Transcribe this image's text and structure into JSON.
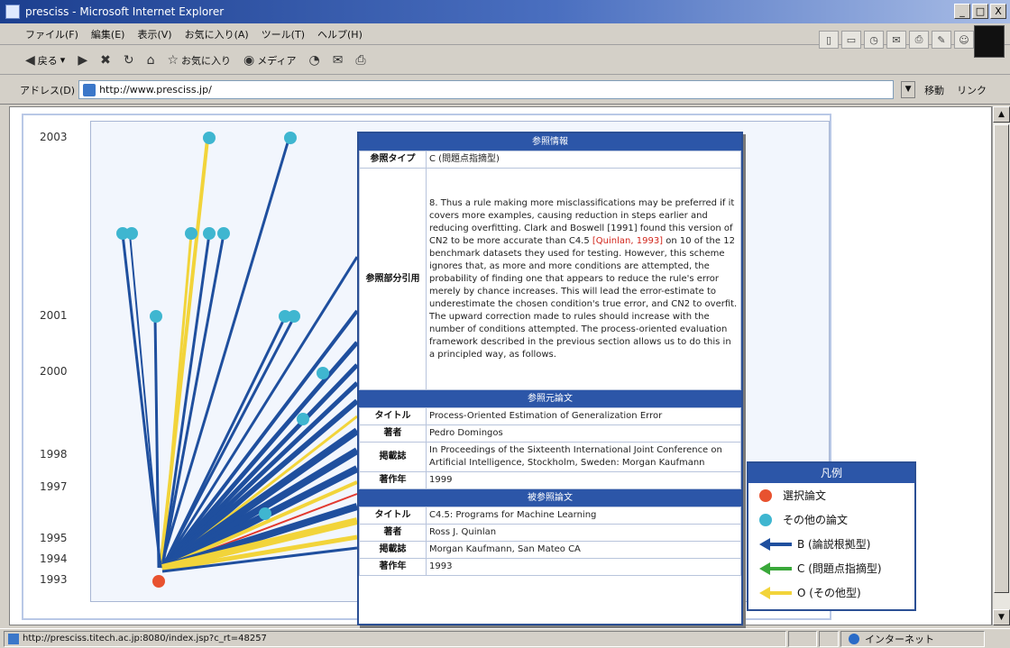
{
  "window": {
    "title": "presciss - Microsoft Internet Explorer",
    "minimize": "_",
    "maximize": "□",
    "close": "X"
  },
  "menu": [
    "ファイル(F)",
    "編集(E)",
    "表示(V)",
    "お気に入り(A)",
    "ツール(T)",
    "ヘルプ(H)"
  ],
  "toolbar": {
    "back": "戻る",
    "favorites": "お気に入り",
    "media": "メディア"
  },
  "address": {
    "label": "アドレス(D)",
    "url": "http://www.presciss.jp/",
    "go": "移動",
    "links": "リンク"
  },
  "years": [
    "2003",
    "2001",
    "2000",
    "1998",
    "1997",
    "1995",
    "1994",
    "1993"
  ],
  "popup": {
    "ref_section": "参照情報",
    "ref_type_label": "参照タイプ",
    "ref_type_value": "C (問題点指摘型)",
    "quote_label": "参照部分引用",
    "quote_pre": "8. Thus a rule making more misclassifications may be preferred if it covers more examples, causing reduction in steps earlier and reducing overfitting. Clark and Boswell [1991] found this version of CN2 to be more accurate than C4.5 ",
    "quote_link": "[Quinlan, 1993]",
    "quote_post": " on 10 of the 12 benchmark datasets they used for testing. However, this scheme ignores that, as more and more conditions are attempted, the probability of finding one that appears to reduce the rule's error merely by chance increases. This will lead the error-estimate to underestimate the chosen condition's true error, and CN2 to overfit. The upward correction made to rules should increase with the number of conditions attempted. The process-oriented evaluation framework described in the previous section allows us to do this in a principled way, as follows.",
    "source_section": "参照元論文",
    "title_label": "タイトル",
    "source_title": "Process-Oriented Estimation of Generalization Error",
    "author_label": "著者",
    "source_author": "Pedro Domingos",
    "venue_label": "掲載誌",
    "source_venue": "In Proceedings of the Sixteenth International Joint Conference on Artificial Intelligence, Stockholm, Sweden: Morgan Kaufmann",
    "year_label": "著作年",
    "source_year": "1999",
    "target_section": "被参照論文",
    "target_title": "C4.5: Programs for Machine Learning",
    "target_author": "Ross J. Quinlan",
    "target_venue": "Morgan Kaufmann, San Mateo CA",
    "target_year": "1993"
  },
  "legend": {
    "title": "凡例",
    "selected_paper": "選択論文",
    "other_paper": "その他の論文",
    "type_b": "B (論説根拠型)",
    "type_c": "C (問題点指摘型)",
    "type_o": "O (その他型)"
  },
  "colors": {
    "selected": "#e8522f",
    "other": "#3fb6d0",
    "type_b": "#1f4f9e",
    "type_c": "#3aa83a",
    "type_o": "#f2d43a"
  },
  "status": {
    "url": "http://presciss.titech.ac.jp:8080/index.jsp?c_rt=48257",
    "zone": "インターネット"
  }
}
